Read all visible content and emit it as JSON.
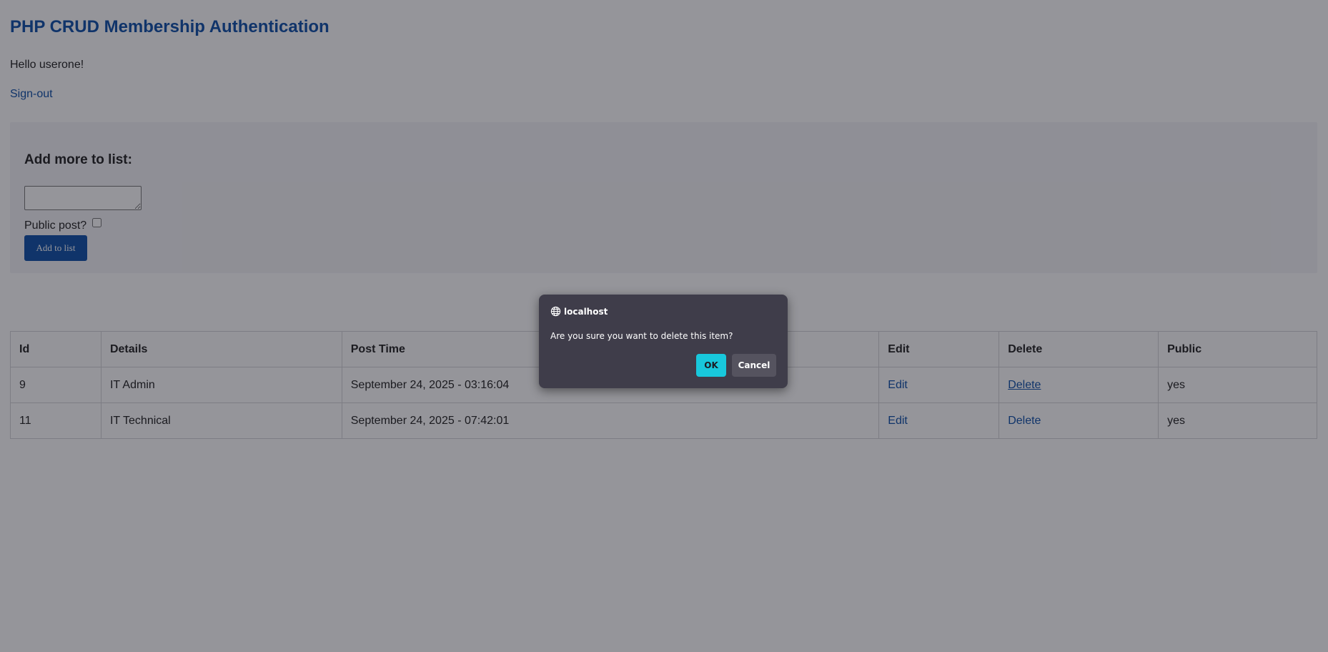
{
  "page": {
    "title": "PHP CRUD Membership Authentication",
    "greeting": "Hello userone!",
    "signout_label": "Sign-out"
  },
  "add_form": {
    "heading": "Add more to list:",
    "details_value": "",
    "public_label": "Public post?",
    "public_checked": false,
    "submit_label": "Add to list"
  },
  "table": {
    "headers": {
      "id": "Id",
      "details": "Details",
      "post_time": "Post Time",
      "edit": "Edit",
      "delete": "Delete",
      "public": "Public"
    },
    "rows": [
      {
        "id": "9",
        "details": "IT Admin",
        "post_time": "September 24, 2025 - 03:16:04",
        "edit": "Edit",
        "delete": "Delete",
        "public": "yes"
      },
      {
        "id": "11",
        "details": "IT Technical",
        "post_time": "September 24, 2025 - 07:42:01",
        "edit": "Edit",
        "delete": "Delete",
        "public": "yes"
      }
    ]
  },
  "dialog": {
    "origin": "localhost",
    "message": "Are you sure you want to delete this item?",
    "ok_label": "OK",
    "cancel_label": "Cancel",
    "icon": "globe-icon"
  },
  "colors": {
    "accent": "#0d4fa8",
    "dialog_background": "#3f3d4a",
    "ok_button": "#18c8dc",
    "cancel_button": "#55535f"
  }
}
